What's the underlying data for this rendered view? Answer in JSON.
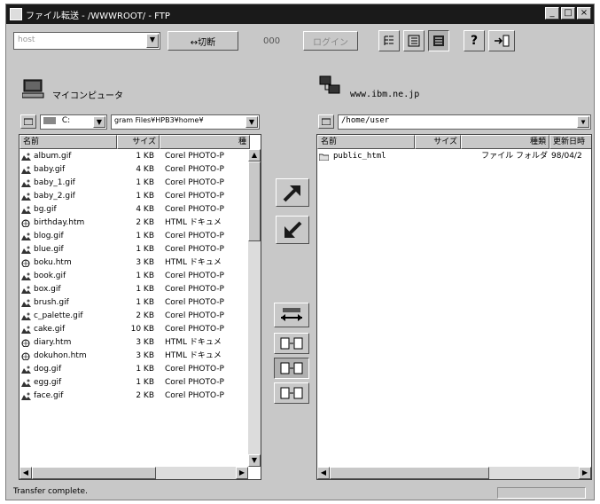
{
  "window": {
    "title": "ファイル転送 - /WWWROOT/ - FTP",
    "minimize_label": "_",
    "maximize_label": "□",
    "close_label": "×"
  },
  "toolbar": {
    "host_combo_value": "host",
    "connect_label": "↔切断",
    "connect_count": "000",
    "disabled_label": "ログイン",
    "view_buttons": [
      "tree-view-icon",
      "list-view-icon",
      "details-view-icon",
      "help-icon",
      "exit-icon"
    ]
  },
  "left": {
    "title": "マイコンピュータ",
    "drive_value": "C:",
    "path_value": "gram Files¥HPB3¥home¥",
    "columns": [
      "名前",
      "サイズ",
      "種"
    ],
    "files": [
      {
        "name": "album.gif",
        "size": "1 KB",
        "type": "Corel PHOTO-P",
        "kind": "image"
      },
      {
        "name": "baby.gif",
        "size": "4 KB",
        "type": "Corel PHOTO-P",
        "kind": "image"
      },
      {
        "name": "baby_1.gif",
        "size": "1 KB",
        "type": "Corel PHOTO-P",
        "kind": "image"
      },
      {
        "name": "baby_2.gif",
        "size": "1 KB",
        "type": "Corel PHOTO-P",
        "kind": "image"
      },
      {
        "name": "bg.gif",
        "size": "4 KB",
        "type": "Corel PHOTO-P",
        "kind": "image"
      },
      {
        "name": "birthday.htm",
        "size": "2 KB",
        "type": "HTML ドキュメ",
        "kind": "html"
      },
      {
        "name": "blog.gif",
        "size": "1 KB",
        "type": "Corel PHOTO-P",
        "kind": "image"
      },
      {
        "name": "blue.gif",
        "size": "1 KB",
        "type": "Corel PHOTO-P",
        "kind": "image"
      },
      {
        "name": "boku.htm",
        "size": "3 KB",
        "type": "HTML ドキュメ",
        "kind": "html"
      },
      {
        "name": "book.gif",
        "size": "1 KB",
        "type": "Corel PHOTO-P",
        "kind": "image"
      },
      {
        "name": "box.gif",
        "size": "1 KB",
        "type": "Corel PHOTO-P",
        "kind": "image"
      },
      {
        "name": "brush.gif",
        "size": "1 KB",
        "type": "Corel PHOTO-P",
        "kind": "image"
      },
      {
        "name": "c_palette.gif",
        "size": "2 KB",
        "type": "Corel PHOTO-P",
        "kind": "image"
      },
      {
        "name": "cake.gif",
        "size": "10 KB",
        "type": "Corel PHOTO-P",
        "kind": "image"
      },
      {
        "name": "diary.htm",
        "size": "3 KB",
        "type": "HTML ドキュメ",
        "kind": "html"
      },
      {
        "name": "dokuhon.htm",
        "size": "3 KB",
        "type": "HTML ドキュメ",
        "kind": "html"
      },
      {
        "name": "dog.gif",
        "size": "1 KB",
        "type": "Corel PHOTO-P",
        "kind": "image"
      },
      {
        "name": "egg.gif",
        "size": "1 KB",
        "type": "Corel PHOTO-P",
        "kind": "image"
      },
      {
        "name": "face.gif",
        "size": "2 KB",
        "type": "Corel PHOTO-P",
        "kind": "image"
      }
    ]
  },
  "right": {
    "title": "www.ibm.ne.jp",
    "path_value": "/home/user",
    "columns": [
      "名前",
      "サイズ",
      "種類",
      "更新日時"
    ],
    "files": [
      {
        "name": "public_html",
        "size": "",
        "type": "ファイル フォルダ",
        "date": "98/04/2"
      }
    ]
  },
  "transfer": {
    "upload_icon": "arrow-up-right-icon",
    "download_icon": "arrow-down-left-icon",
    "sync_icon": "sync-icon"
  },
  "status": {
    "text": "Transfer complete."
  },
  "colors": {
    "titlebar": "#1a1a1a",
    "face": "#c8c8c8",
    "arrow_dark": "#1a1a1a"
  }
}
